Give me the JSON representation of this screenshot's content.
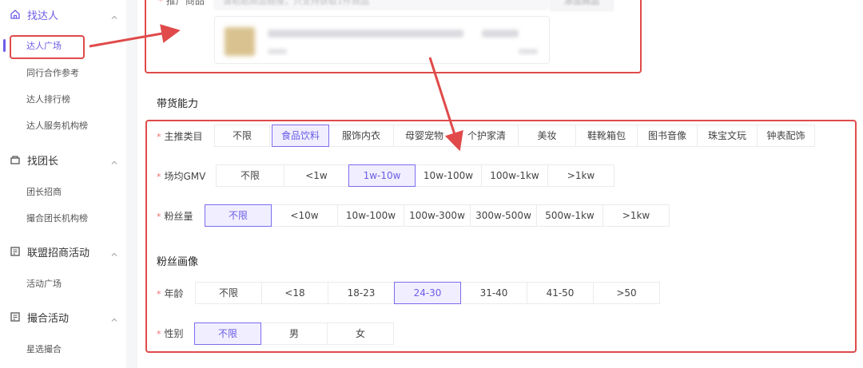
{
  "sidebar": {
    "groups": [
      {
        "label": "找达人",
        "icon": "home-icon",
        "items": [
          "达人广场",
          "同行合作参考",
          "达人排行榜",
          "达人服务机构榜"
        ]
      },
      {
        "label": "找团长",
        "icon": "shop-icon",
        "items": [
          "团长招商",
          "撮合团长机构榜"
        ]
      },
      {
        "label": "联盟招商活动",
        "icon": "activity-icon",
        "items": [
          "活动广场"
        ]
      },
      {
        "label": "撮合活动",
        "icon": "activity-icon",
        "items": [
          "星选撮合"
        ]
      }
    ]
  },
  "product": {
    "label": "推广商品",
    "placeholder": "请粘贴商品链接，只支持获取1件商品",
    "add_button": "添加商品"
  },
  "filters": {
    "section_title": "带货能力",
    "category": {
      "label": "主推类目",
      "options": [
        "不限",
        "食品饮料",
        "服饰内衣",
        "母婴宠物",
        "个护家清",
        "美妆",
        "鞋靴箱包",
        "图书音像",
        "珠宝文玩",
        "钟表配饰"
      ],
      "selected": "食品饮料"
    },
    "gmv": {
      "label": "场均GMV",
      "options": [
        "不限",
        "<1w",
        "1w-10w",
        "10w-100w",
        "100w-1kw",
        ">1kw"
      ],
      "selected": "1w-10w"
    },
    "fans": {
      "label": "粉丝量",
      "options": [
        "不限",
        "<10w",
        "10w-100w",
        "100w-300w",
        "300w-500w",
        "500w-1kw",
        ">1kw"
      ],
      "selected": "不限"
    }
  },
  "portrait": {
    "section_title": "粉丝画像",
    "age": {
      "label": "年龄",
      "options": [
        "不限",
        "<18",
        "18-23",
        "24-30",
        "31-40",
        "41-50",
        ">50"
      ],
      "selected": "24-30"
    },
    "gender": {
      "label": "性别",
      "options": [
        "不限",
        "男",
        "女"
      ],
      "selected": "不限"
    }
  },
  "colors": {
    "accent": "#6c5ce7",
    "annotation": "#e04a4a"
  }
}
